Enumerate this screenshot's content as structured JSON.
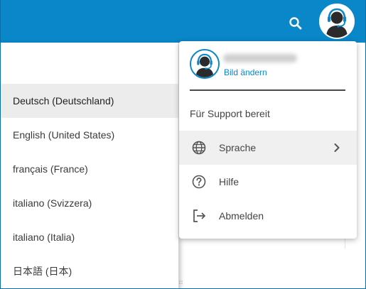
{
  "header": {
    "search_icon": "search-icon",
    "avatar_icon": "support-agent-avatar"
  },
  "user_menu": {
    "change_picture": "Bild ändern",
    "status": "Für Support bereit",
    "items": [
      {
        "label": "Sprache",
        "icon": "globe-icon",
        "has_submenu": true
      },
      {
        "label": "Hilfe",
        "icon": "help-circle-icon",
        "has_submenu": false
      },
      {
        "label": "Abmelden",
        "icon": "logout-icon",
        "has_submenu": false
      }
    ]
  },
  "language_menu": {
    "selected": "Deutsch (Deutschland)",
    "items": [
      {
        "label": "Deutsch (Deutschland)"
      },
      {
        "label": "English (United States)"
      },
      {
        "label": "français (France)"
      },
      {
        "label": "italiano (Svizzera)"
      },
      {
        "label": "italiano (Italia)"
      },
      {
        "label": "日本語 (日本)"
      }
    ]
  },
  "colors": {
    "brand": "#0a87c9",
    "selected_bg": "#ececec",
    "hover_bg": "#f0f0f0"
  }
}
